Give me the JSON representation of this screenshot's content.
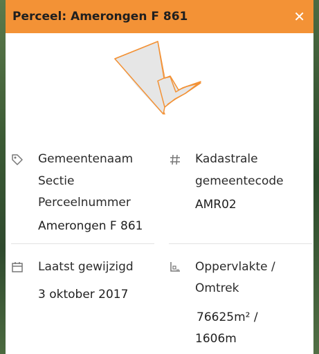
{
  "header": {
    "title": "Perceel: Amerongen F 861",
    "close_symbol": "✕"
  },
  "colors": {
    "header_bg": "#f39236",
    "shape_outline": "#f39236",
    "shape_fill": "#e6e6e6"
  },
  "left": {
    "gemeente_label": "Gemeentenaam",
    "sectie_label": "Sectie",
    "perceel_label": "Perceelnummer",
    "perceel_value": "Amerongen F 861",
    "date_label": "Laatst gewijzigd",
    "date_value": "3 oktober 2017"
  },
  "right": {
    "kad_label_line1": "Kadastrale",
    "kad_label_line2": "gemeentecode",
    "kad_value": "AMR02",
    "opp_label_line1": "Oppervlakte /",
    "opp_label_line2": "Omtrek",
    "opp_value": "76625m² /",
    "omtrek_value": "1606m"
  },
  "icons": {
    "tag": "tag-icon",
    "hash": "hash-icon",
    "calendar": "calendar-icon",
    "area": "area-icon"
  }
}
